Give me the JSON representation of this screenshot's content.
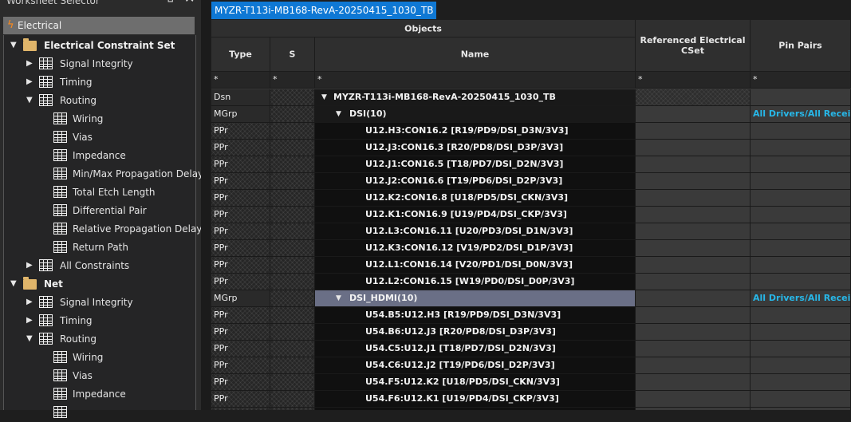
{
  "worksheet_selector": {
    "title": "Worksheet Selector",
    "pin_icon": "restore-window-icon",
    "close_icon": "close-icon",
    "section_label": "Electrical",
    "section_icon": "lightning-icon",
    "tree": [
      {
        "label": "Electrical Constraint Set",
        "level": 0,
        "kind": "folder",
        "expanded": true,
        "bold": true
      },
      {
        "label": "Signal Integrity",
        "level": 1,
        "kind": "folder-grid",
        "expanded": false
      },
      {
        "label": "Timing",
        "level": 1,
        "kind": "folder-grid",
        "expanded": false
      },
      {
        "label": "Routing",
        "level": 1,
        "kind": "folder-grid",
        "expanded": true
      },
      {
        "label": "Wiring",
        "level": 2,
        "kind": "grid"
      },
      {
        "label": "Vias",
        "level": 2,
        "kind": "grid"
      },
      {
        "label": "Impedance",
        "level": 2,
        "kind": "grid"
      },
      {
        "label": "Min/Max Propagation Delays",
        "level": 2,
        "kind": "grid"
      },
      {
        "label": "Total Etch Length",
        "level": 2,
        "kind": "grid"
      },
      {
        "label": "Differential Pair",
        "level": 2,
        "kind": "grid"
      },
      {
        "label": "Relative Propagation Delay",
        "level": 2,
        "kind": "grid"
      },
      {
        "label": "Return Path",
        "level": 2,
        "kind": "grid"
      },
      {
        "label": "All Constraints",
        "level": 1,
        "kind": "folder-grid",
        "expanded": false
      },
      {
        "label": "Net",
        "level": 0,
        "kind": "folder",
        "expanded": true,
        "bold": true
      },
      {
        "label": "Signal Integrity",
        "level": 1,
        "kind": "folder-grid",
        "expanded": false
      },
      {
        "label": "Timing",
        "level": 1,
        "kind": "folder-grid",
        "expanded": false
      },
      {
        "label": "Routing",
        "level": 1,
        "kind": "folder-grid",
        "expanded": true
      },
      {
        "label": "Wiring",
        "level": 2,
        "kind": "grid"
      },
      {
        "label": "Vias",
        "level": 2,
        "kind": "grid"
      },
      {
        "label": "Impedance",
        "level": 2,
        "kind": "grid"
      },
      {
        "label": "",
        "level": 2,
        "kind": "grid"
      }
    ]
  },
  "tab": {
    "label": "MYZR-T113i-MB168-RevA-20250415_1030_TB"
  },
  "sheet": {
    "objects_header": "Objects",
    "columns": {
      "type": "Type",
      "s": "S",
      "name": "Name",
      "ref": "Referenced Electrical CSet",
      "pin": "Pin Pairs"
    },
    "filter": {
      "type": "*",
      "s": "*",
      "name": "*",
      "ref": "*",
      "pin": "*"
    },
    "rows": [
      {
        "type": "Dsn",
        "name": "MYZR-T113i-MB168-RevA-20250415_1030_TB",
        "indent": 0,
        "expander": "▼",
        "pin": "",
        "kind": "dsn"
      },
      {
        "type": "MGrp",
        "name": "DSI(10)",
        "indent": 1,
        "expander": "▼",
        "pin": "All Drivers/All Receivers",
        "kind": "mgrp"
      },
      {
        "type": "PPr",
        "name": "U12.H3:CON16.2 [R19/PD9/DSI_D3N/3V3]",
        "indent": 2,
        "expander": "",
        "pin": "",
        "kind": "ppr"
      },
      {
        "type": "PPr",
        "name": "U12.J3:CON16.3 [R20/PD8/DSI_D3P/3V3]",
        "indent": 2,
        "expander": "",
        "pin": "",
        "kind": "ppr"
      },
      {
        "type": "PPr",
        "name": "U12.J1:CON16.5 [T18/PD7/DSI_D2N/3V3]",
        "indent": 2,
        "expander": "",
        "pin": "",
        "kind": "ppr"
      },
      {
        "type": "PPr",
        "name": "U12.J2:CON16.6 [T19/PD6/DSI_D2P/3V3]",
        "indent": 2,
        "expander": "",
        "pin": "",
        "kind": "ppr"
      },
      {
        "type": "PPr",
        "name": "U12.K2:CON16.8 [U18/PD5/DSI_CKN/3V3]",
        "indent": 2,
        "expander": "",
        "pin": "",
        "kind": "ppr"
      },
      {
        "type": "PPr",
        "name": "U12.K1:CON16.9 [U19/PD4/DSI_CKP/3V3]",
        "indent": 2,
        "expander": "",
        "pin": "",
        "kind": "ppr"
      },
      {
        "type": "PPr",
        "name": "U12.L3:CON16.11 [U20/PD3/DSI_D1N/3V3]",
        "indent": 2,
        "expander": "",
        "pin": "",
        "kind": "ppr"
      },
      {
        "type": "PPr",
        "name": "U12.K3:CON16.12 [V19/PD2/DSI_D1P/3V3]",
        "indent": 2,
        "expander": "",
        "pin": "",
        "kind": "ppr"
      },
      {
        "type": "PPr",
        "name": "U12.L1:CON16.14 [V20/PD1/DSI_D0N/3V3]",
        "indent": 2,
        "expander": "",
        "pin": "",
        "kind": "ppr"
      },
      {
        "type": "PPr",
        "name": "U12.L2:CON16.15 [W19/PD0/DSI_D0P/3V3]",
        "indent": 2,
        "expander": "",
        "pin": "",
        "kind": "ppr"
      },
      {
        "type": "MGrp",
        "name": "DSI_HDMI(10)",
        "indent": 1,
        "expander": "▼",
        "pin": "All Drivers/All Receivers",
        "kind": "mgrp sel"
      },
      {
        "type": "PPr",
        "name": "U54.B5:U12.H3 [R19/PD9/DSI_D3N/3V3]",
        "indent": 2,
        "expander": "",
        "pin": "",
        "kind": "ppr"
      },
      {
        "type": "PPr",
        "name": "U54.B6:U12.J3 [R20/PD8/DSI_D3P/3V3]",
        "indent": 2,
        "expander": "",
        "pin": "",
        "kind": "ppr"
      },
      {
        "type": "PPr",
        "name": "U54.C5:U12.J1 [T18/PD7/DSI_D2N/3V3]",
        "indent": 2,
        "expander": "",
        "pin": "",
        "kind": "ppr"
      },
      {
        "type": "PPr",
        "name": "U54.C6:U12.J2 [T19/PD6/DSI_D2P/3V3]",
        "indent": 2,
        "expander": "",
        "pin": "",
        "kind": "ppr"
      },
      {
        "type": "PPr",
        "name": "U54.F5:U12.K2 [U18/PD5/DSI_CKN/3V3]",
        "indent": 2,
        "expander": "",
        "pin": "",
        "kind": "ppr"
      },
      {
        "type": "PPr",
        "name": "U54.F6:U12.K1 [U19/PD4/DSI_CKP/3V3]",
        "indent": 2,
        "expander": "",
        "pin": "",
        "kind": "ppr"
      },
      {
        "type": "PPr",
        "name": "",
        "indent": 2,
        "expander": "",
        "pin": "",
        "kind": "ppr"
      }
    ]
  },
  "colors": {
    "accent": "#0f78d4",
    "link": "#27b7e8",
    "selected_row": "#6a6f86",
    "folder": "#e0b56a",
    "lightning": "#ff8a1a"
  }
}
